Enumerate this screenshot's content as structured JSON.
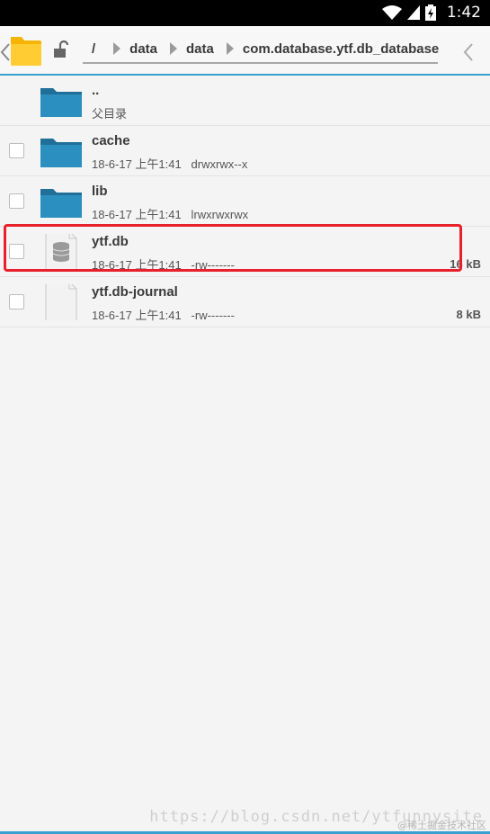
{
  "status_bar": {
    "time": "1:42",
    "icons": [
      "wifi-icon",
      "signal-icon",
      "battery-icon"
    ]
  },
  "toolbar": {
    "icons": [
      "back-chevron-icon",
      "folder-icon",
      "lock-icon",
      "forward-chevron-icon"
    ],
    "breadcrumb": {
      "root": "/",
      "items": [
        "data",
        "data",
        "com.database.ytf.db_database"
      ]
    }
  },
  "files": [
    {
      "name": "..",
      "meta": "父目录",
      "size": "",
      "icon": "folder-icon",
      "checkbox": false
    },
    {
      "name": "cache",
      "meta": "18-6-17 上午1:41   drwxrwx--x",
      "size": "",
      "icon": "folder-icon",
      "checkbox": true
    },
    {
      "name": "lib",
      "meta": "18-6-17 上午1:41   lrwxrwxrwx",
      "size": "",
      "icon": "folder-icon",
      "checkbox": true
    },
    {
      "name": "ytf.db",
      "meta": "18-6-17 上午1:41   -rw-------",
      "size": "16 kB",
      "icon": "database-file-icon",
      "checkbox": true
    },
    {
      "name": "ytf.db-journal",
      "meta": "18-6-17 上午1:41   -rw-------",
      "size": "8 kB",
      "icon": "file-icon",
      "checkbox": true
    }
  ],
  "colors": {
    "accent": "#3aa0cf",
    "folder": "#2b8fc0",
    "highlight": "#e8202a"
  },
  "watermark": {
    "text": "https://blog.csdn.net/ytfunnysite",
    "sub": "@稀土掘金技术社区"
  }
}
